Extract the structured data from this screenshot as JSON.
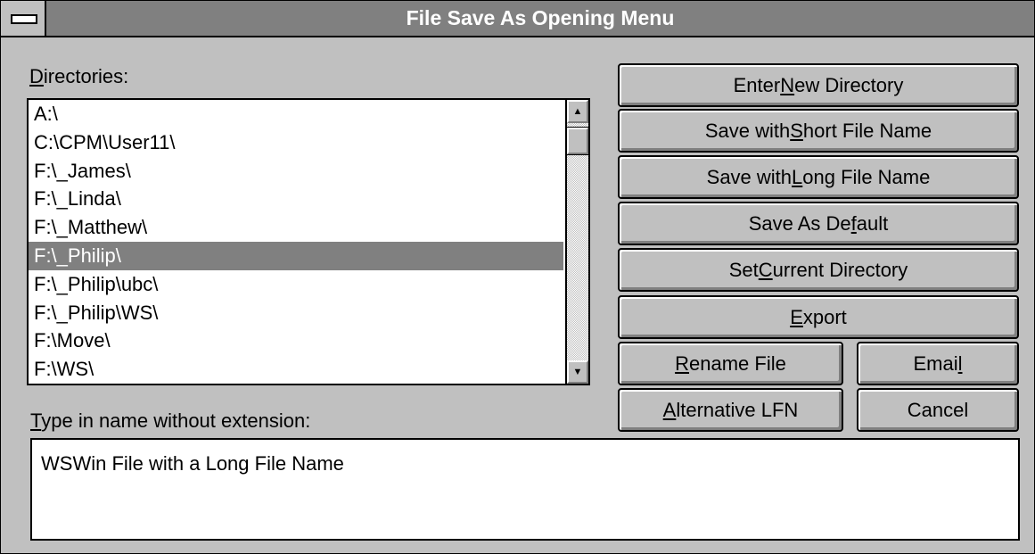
{
  "window": {
    "title": "File Save As Opening Menu",
    "system_menu_icon": "system-menu-box"
  },
  "directories": {
    "label_mnemonic": "D",
    "label_rest": "irectories:",
    "items": [
      {
        "label": "A:\\",
        "selected": false
      },
      {
        "label": "C:\\CPM\\User11\\",
        "selected": false
      },
      {
        "label": "F:\\_James\\",
        "selected": false
      },
      {
        "label": "F:\\_Linda\\",
        "selected": false
      },
      {
        "label": "F:\\_Matthew\\",
        "selected": false
      },
      {
        "label": "F:\\_Philip\\",
        "selected": true
      },
      {
        "label": "F:\\_Philip\\ubc\\",
        "selected": false
      },
      {
        "label": "F:\\_Philip\\WS\\",
        "selected": false
      },
      {
        "label": "F:\\Move\\",
        "selected": false
      },
      {
        "label": "F:\\WS\\",
        "selected": false
      }
    ],
    "scroll_up_icon": "▲",
    "scroll_down_icon": "▼"
  },
  "buttons": {
    "enter_new_directory": {
      "pre": "Enter ",
      "key": "N",
      "post": "ew Directory"
    },
    "save_short": {
      "pre": "Save with ",
      "key": "S",
      "post": "hort File Name"
    },
    "save_long": {
      "pre": "Save with ",
      "key": "L",
      "post": "ong File Name"
    },
    "save_default": {
      "pre": "Save As De",
      "key": "f",
      "post": "ault"
    },
    "set_current_directory": {
      "pre": "Set ",
      "key": "C",
      "post": "urrent Directory"
    },
    "export": {
      "pre": "",
      "key": "E",
      "post": "xport"
    },
    "rename_file": {
      "pre": "",
      "key": "R",
      "post": "ename File"
    },
    "email": {
      "pre": "Emai",
      "key": "l",
      "post": ""
    },
    "alternative_lfn": {
      "pre": "",
      "key": "A",
      "post": "lternative LFN"
    },
    "cancel": {
      "pre": "Cancel",
      "key": "",
      "post": ""
    }
  },
  "name_input": {
    "label_mnemonic": "T",
    "label_rest": "ype in name without extension:",
    "value": "WSWin File with a Long File Name"
  }
}
